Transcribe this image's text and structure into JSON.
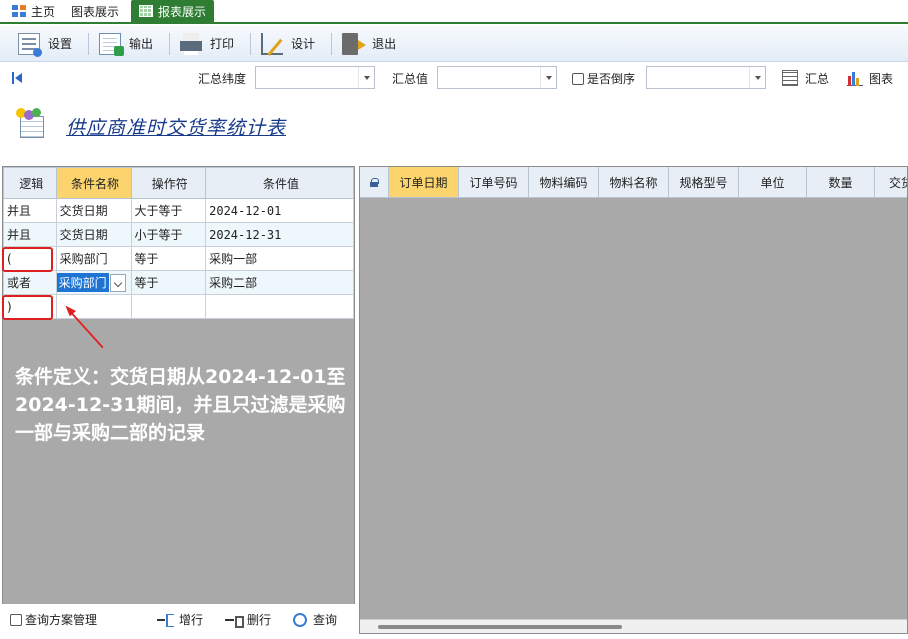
{
  "tabs": [
    {
      "label": "主页",
      "icon": "home-icon"
    },
    {
      "label": "图表展示",
      "icon": ""
    },
    {
      "label": "报表展示",
      "icon": "grid-icon"
    }
  ],
  "toolbar": {
    "settings": "设置",
    "export": "输出",
    "print": "打印",
    "design": "设计",
    "exit": "退出"
  },
  "filter": {
    "summary_dimension_label": "汇总纬度",
    "summary_dimension_value": "",
    "summary_value_label": "汇总值",
    "summary_value_value": "",
    "reverse_label": "是否倒序",
    "reverse_select_value": "",
    "summary_button": "汇总",
    "chart_button": "图表"
  },
  "report": {
    "title": "供应商准时交货率统计表"
  },
  "conditions": {
    "headers": [
      "逻辑",
      "条件名称",
      "操作符",
      "条件值"
    ],
    "rows": [
      {
        "logic": "并且",
        "name": "交货日期",
        "op": "大于等于",
        "value": "2024-12-01"
      },
      {
        "logic": "并且",
        "name": "交货日期",
        "op": "小于等于",
        "value": "2024-12-31"
      },
      {
        "logic": "(",
        "name": "采购部门",
        "op": "等于",
        "value": "采购一部"
      },
      {
        "logic": "或者",
        "name": "采购部门",
        "op": "等于",
        "value": "采购二部"
      },
      {
        "logic": ")",
        "name": "",
        "op": "",
        "value": ""
      }
    ]
  },
  "annotation": "条件定义：交货日期从2024-12-01至2024-12-31期间，并且只过滤是采购一部与采购二部的记录",
  "bottom": {
    "scheme_manage": "查询方案管理",
    "add_row": "增行",
    "delete_row": "删行",
    "query": "查询"
  },
  "result_grid": {
    "headers": [
      "订单日期",
      "订单号码",
      "物料编码",
      "物料名称",
      "规格型号",
      "单位",
      "数量",
      "交货"
    ]
  },
  "colors": {
    "tab_active": "#2e7d32",
    "header_highlight": "#fbd46e",
    "selection": "#1e74d2",
    "annotation_box": "#e02020",
    "title": "#173b8a"
  }
}
